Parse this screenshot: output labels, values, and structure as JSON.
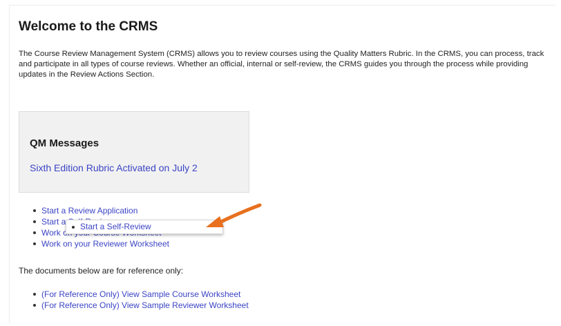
{
  "header": {
    "title": "Welcome to the CRMS"
  },
  "intro": {
    "text": "The Course Review Management System (CRMS) allows you to review courses using the Quality Matters Rubric. In the CRMS, you can process, track and participate in all types of course reviews. Whether an official, internal or self-review, the CRMS guides you through the process while providing updates in the Review Actions Section."
  },
  "messages": {
    "title": "QM Messages",
    "link": "Sixth Edition Rubric Activated on July 2"
  },
  "actions": {
    "items": [
      {
        "label": "Start a Review Application"
      },
      {
        "label": "Start a Self-Review"
      },
      {
        "label": "Work on your Course Worksheet"
      },
      {
        "label": "Work on your Reviewer Worksheet"
      }
    ]
  },
  "popup": {
    "label": "Start a Self-Review"
  },
  "reference": {
    "text": "The documents below are for reference only:",
    "items": [
      {
        "label": "(For Reference Only) View Sample Course Worksheet"
      },
      {
        "label": "(For Reference Only) View Sample Reviewer Worksheet"
      }
    ]
  },
  "annotation": {
    "arrow_icon": "orange-arrow-icon",
    "arrow_color": "#e8701e"
  },
  "colors": {
    "link": "#3b44c4",
    "box_bg": "#f1f1f1"
  }
}
